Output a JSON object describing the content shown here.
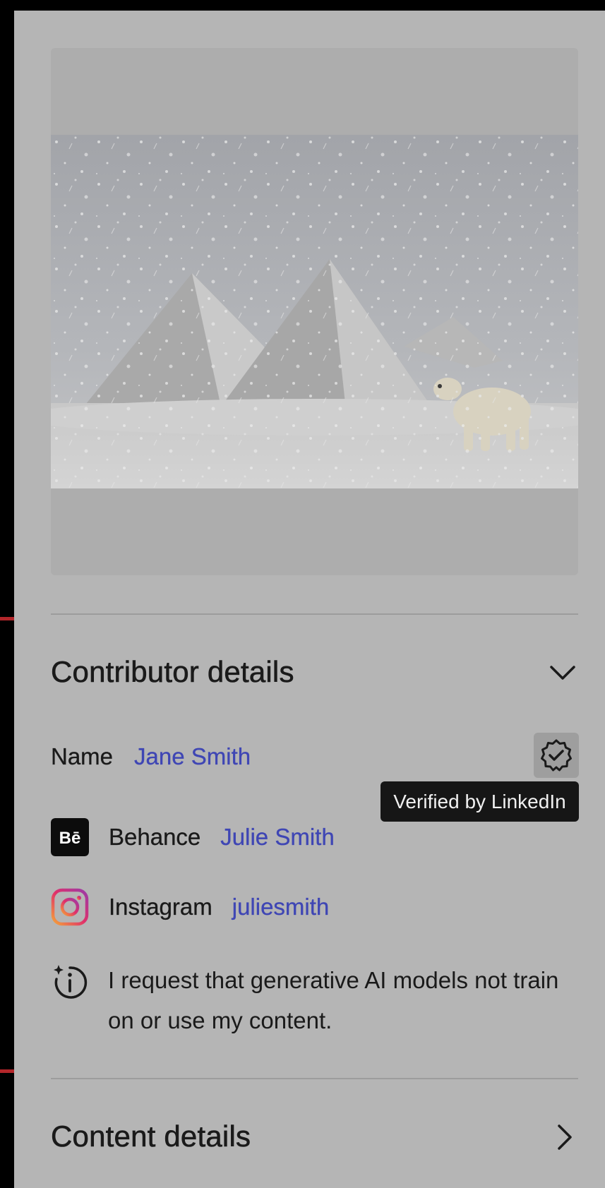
{
  "preview": {
    "image_alt": "Polar bear walking in the snow in front of snow-covered pyramids"
  },
  "contributor": {
    "section_title": "Contributor details",
    "name_label": "Name",
    "name_value": "Jane Smith",
    "verified_tooltip": "Verified by LinkedIn",
    "behance_label": "Behance",
    "behance_value": "Julie Smith",
    "behance_logo_text": "Bē",
    "instagram_label": "Instagram",
    "instagram_value": "juliesmith",
    "ai_notice": "I request that generative AI models not train on or use my content."
  },
  "content": {
    "section_title": "Content details"
  },
  "icons": {
    "contributor_chevron": "chevron-down-icon",
    "content_chevron": "chevron-right-icon",
    "verified": "verified-badge-icon",
    "behance": "behance-icon",
    "instagram": "instagram-icon",
    "ai": "ai-info-icon"
  },
  "colors": {
    "link": "#3f46b4",
    "tooltip_bg": "#161616",
    "panel_bg": "#b5b5b5",
    "accent_marker": "#b3262a"
  }
}
